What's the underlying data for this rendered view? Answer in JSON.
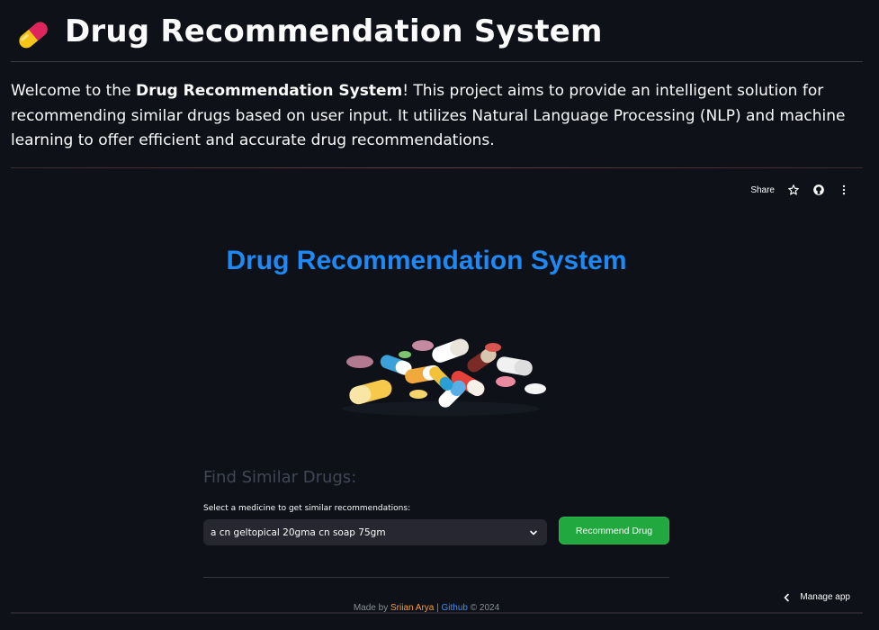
{
  "header": {
    "icon": "pill-icon",
    "title": "Drug Recommendation System"
  },
  "intro": {
    "prefix": "Welcome to the ",
    "bold": "Drug Recommendation System",
    "suffix": "! This project aims to provide an intelligent solution for recommending similar drugs based on user input. It utilizes Natural Language Processing (NLP) and machine learning to offer efficient and accurate drug recommendations."
  },
  "embed": {
    "toolbar": {
      "share_label": "Share",
      "star_icon": "star-icon",
      "github_icon": "github-icon",
      "menu_icon": "more-vertical-icon"
    },
    "app_title": "Drug Recommendation System",
    "image_icon": "pills-image",
    "find_heading": "Find Similar Drugs:",
    "select": {
      "label": "Select a medicine to get similar recommendations:",
      "value": "a cn geltopical 20gma cn soap 75gm"
    },
    "recommend_button": "Recommend Drug",
    "footer": {
      "made_by": "Made by ",
      "author": "Sriian Arya",
      "sep": " | ",
      "github": "Github",
      "copyright": " © 2024"
    },
    "manage_app": "Manage app"
  },
  "colors": {
    "background": "#0e1117",
    "app_title": "#1e88f5",
    "button": "#21a83f",
    "author_link": "#ff9d2b",
    "github_link": "#3b8ef5"
  }
}
